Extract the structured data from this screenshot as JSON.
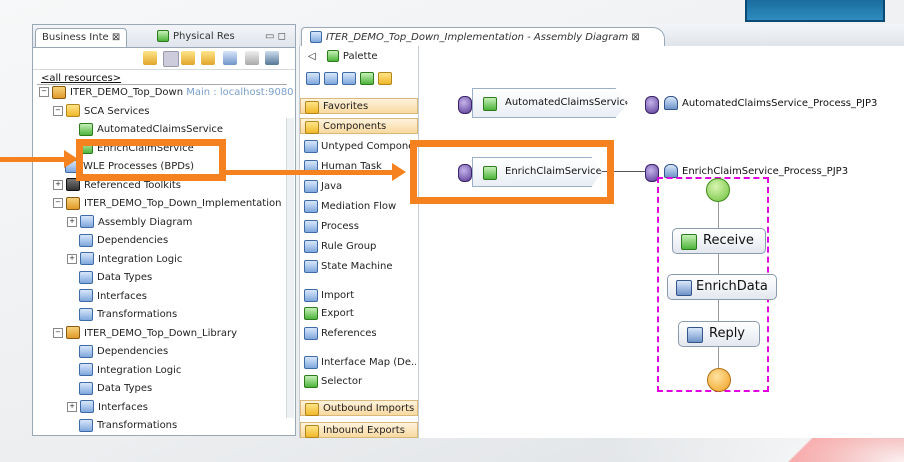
{
  "left_panel": {
    "tabs": [
      {
        "label": "Business Inte ⊠"
      },
      {
        "label": "Physical Res"
      }
    ],
    "min_max": "▭ ◻",
    "resources_label": "<all resources>",
    "tree": [
      {
        "label": "ITER_DEMO_Top_Down",
        "suffix": " Main : localhost:9080",
        "indent": 0,
        "twisty": "−",
        "icon": "proj"
      },
      {
        "label": "SCA Services",
        "indent": 1,
        "twisty": "−",
        "icon": "folder"
      },
      {
        "label": "AutomatedClaimsService",
        "indent": 2,
        "twisty": "",
        "icon": "green"
      },
      {
        "label": "EnrichClaimService",
        "indent": 2,
        "twisty": "",
        "icon": "green"
      },
      {
        "label": "WLE Processes (BPDs)",
        "indent": 1,
        "twisty": "",
        "icon": "blue"
      },
      {
        "label": "Referenced Toolkits",
        "indent": 1,
        "twisty": "+",
        "icon": "dark"
      },
      {
        "label": "ITER_DEMO_Top_Down_Implementation",
        "indent": 1,
        "twisty": "−",
        "icon": "proj"
      },
      {
        "label": "Assembly Diagram",
        "indent": 2,
        "twisty": "+",
        "icon": "blue"
      },
      {
        "label": "Dependencies",
        "indent": 2,
        "twisty": "",
        "icon": "blue"
      },
      {
        "label": "Integration Logic",
        "indent": 2,
        "twisty": "+",
        "icon": "blue"
      },
      {
        "label": "Data Types",
        "indent": 2,
        "twisty": "",
        "icon": "blue"
      },
      {
        "label": "Interfaces",
        "indent": 2,
        "twisty": "",
        "icon": "blue"
      },
      {
        "label": "Transformations",
        "indent": 2,
        "twisty": "",
        "icon": "blue"
      },
      {
        "label": "ITER_DEMO_Top_Down_Library",
        "indent": 1,
        "twisty": "−",
        "icon": "proj"
      },
      {
        "label": "Dependencies",
        "indent": 2,
        "twisty": "",
        "icon": "blue"
      },
      {
        "label": "Integration Logic",
        "indent": 2,
        "twisty": "",
        "icon": "blue"
      },
      {
        "label": "Data Types",
        "indent": 2,
        "twisty": "",
        "icon": "blue"
      },
      {
        "label": "Interfaces",
        "indent": 2,
        "twisty": "+",
        "icon": "blue"
      },
      {
        "label": "Transformations",
        "indent": 2,
        "twisty": "",
        "icon": "blue"
      }
    ]
  },
  "editor": {
    "tab_label": "ITER_DEMO_Top_Down_Implementation - Assembly Diagram ⊠"
  },
  "palette": {
    "title": "Palette",
    "drawers_top": [
      {
        "label": "Favorites"
      },
      {
        "label": "Components"
      }
    ],
    "items": [
      {
        "label": "Untyped Component",
        "icon": "blue"
      },
      {
        "label": "Human Task",
        "icon": "blue"
      },
      {
        "label": "Java",
        "icon": "blue"
      },
      {
        "label": "Mediation Flow",
        "icon": "blue"
      },
      {
        "label": "Process",
        "icon": "blue"
      },
      {
        "label": "Rule Group",
        "icon": "blue"
      },
      {
        "label": "State Machine",
        "icon": "blue"
      },
      {
        "label": "Import",
        "icon": "blue"
      },
      {
        "label": "Export",
        "icon": "green"
      },
      {
        "label": "References",
        "icon": "blue"
      },
      {
        "label": "Interface Map (De...",
        "icon": "blue"
      },
      {
        "label": "Selector",
        "icon": "green"
      }
    ],
    "drawers_bottom": [
      {
        "label": "Outbound Imports"
      },
      {
        "label": "Inbound Exports"
      }
    ]
  },
  "diagram": {
    "components": [
      {
        "label": "AutomatedClaimsService"
      },
      {
        "label": "EnrichClaimService"
      }
    ],
    "exports": [
      {
        "label": "AutomatedClaimsService_Process_PJP3"
      },
      {
        "label": "EnrichClaimService_Process_PJP3"
      }
    ],
    "activities": [
      {
        "label": "Receive"
      },
      {
        "label": "EnrichData"
      },
      {
        "label": "Reply"
      }
    ]
  },
  "colors": {
    "highlight": "#f5821f",
    "process_border": "#e000e0"
  }
}
